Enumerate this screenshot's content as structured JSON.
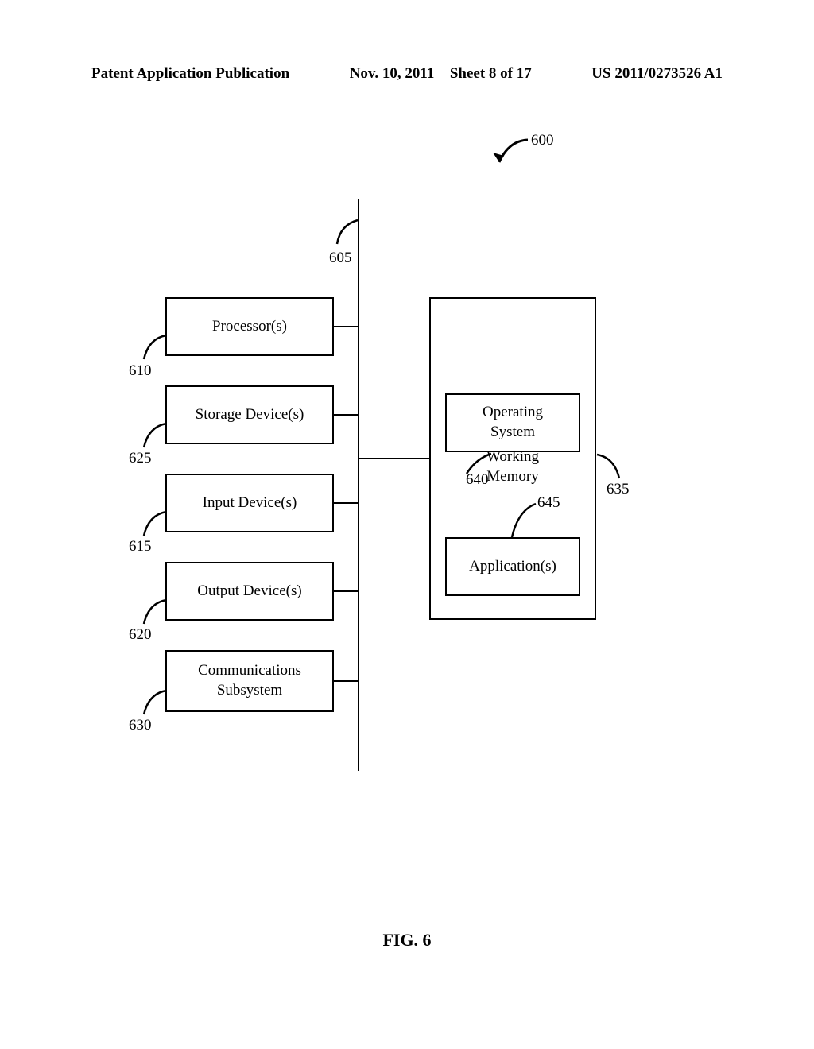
{
  "header": {
    "publication_type": "Patent Application Publication",
    "date": "Nov. 10, 2011",
    "sheet": "Sheet 8 of 17",
    "pub_number": "US 2011/0273526 A1"
  },
  "diagram": {
    "system_ref": "600",
    "bus_ref": "605",
    "blocks": {
      "processor": {
        "label": "Processor(s)",
        "ref": "610"
      },
      "storage": {
        "label": "Storage Device(s)",
        "ref": "625"
      },
      "input": {
        "label": "Input Device(s)",
        "ref": "615"
      },
      "output": {
        "label": "Output Device(s)",
        "ref": "620"
      },
      "comm": {
        "label": "Communications\nSubsystem",
        "ref": "630"
      },
      "working_memory": {
        "label": "Working\nMemory",
        "ref": "635"
      },
      "os": {
        "label": "Operating\nSystem",
        "ref": "640"
      },
      "app": {
        "label": "Application(s)",
        "ref": "645"
      }
    }
  },
  "figure_label": "FIG. 6"
}
